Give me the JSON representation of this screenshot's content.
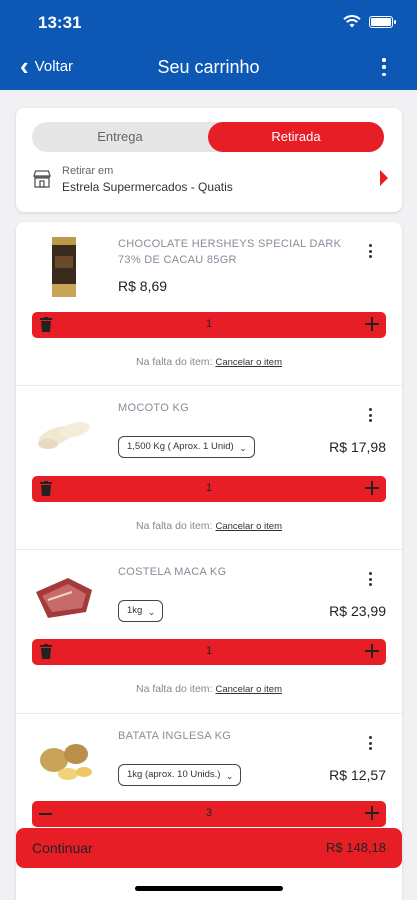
{
  "status_bar": {
    "time": "13:31"
  },
  "nav": {
    "back_label": "Voltar",
    "title": "Seu carrinho"
  },
  "delivery": {
    "options": [
      "Entrega",
      "Retirada"
    ],
    "selected": "Retirada",
    "pickup_label": "Retirar em",
    "pickup_store": "Estrela Supermercados - Quatis"
  },
  "items": [
    {
      "name": "CHOCOLATE HERSHEYS SPECIAL DARK 73% DE CACAU 85GR",
      "price": "R$ 8,69",
      "unit_option": "",
      "quantity": "1",
      "missing_text": "Na falta do item:",
      "cancel_label": "Cancelar o item",
      "thumb_icon": "chocolate-bar-icon"
    },
    {
      "name": "MOCOTO KG",
      "price": "R$ 17,98",
      "unit_option": "1,500 Kg ( Aprox. 1 Unid)",
      "quantity": "1",
      "missing_text": "Na falta do item:",
      "cancel_label": "Cancelar o item",
      "thumb_icon": "mocoto-icon"
    },
    {
      "name": "COSTELA MACA KG",
      "price": "R$ 23,99",
      "unit_option": "1kg",
      "quantity": "1",
      "missing_text": "Na falta do item:",
      "cancel_label": "Cancelar o item",
      "thumb_icon": "ribs-icon"
    },
    {
      "name": "BATATA INGLESA KG",
      "price": "R$ 12,57",
      "unit_option": "1kg (aprox. 10 Unids.)",
      "quantity": "3",
      "missing_text": "",
      "cancel_label": "",
      "thumb_icon": "potato-icon"
    }
  ],
  "footer": {
    "continue_label": "Continuar",
    "total": "R$ 148,18"
  },
  "colors": {
    "primary": "#0c58b4",
    "accent": "#e81e26"
  }
}
